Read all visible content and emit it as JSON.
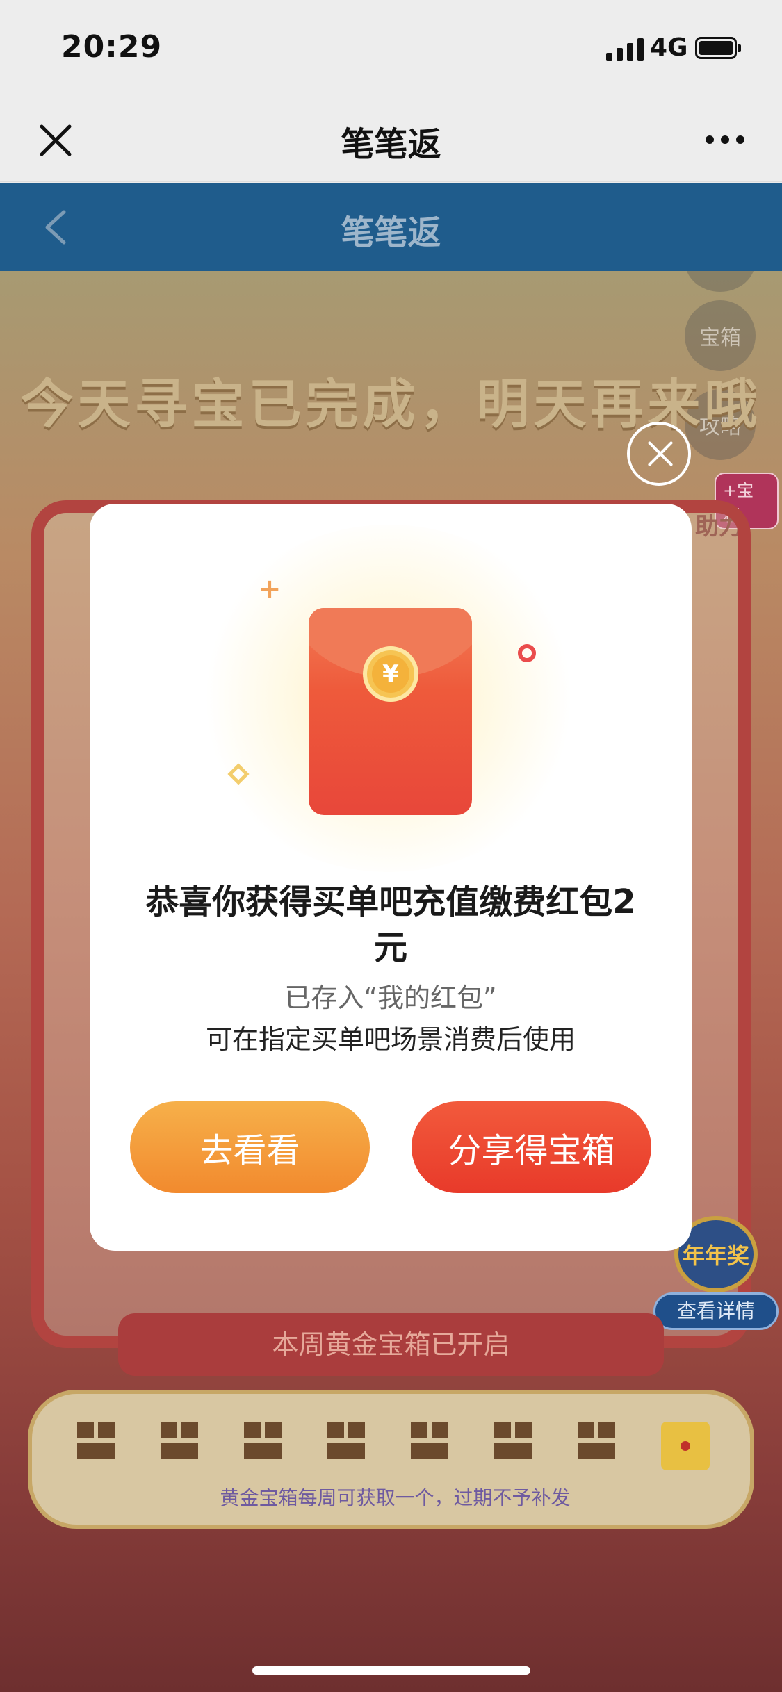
{
  "status_bar": {
    "time": "20:29",
    "network": "4G"
  },
  "wechat_nav": {
    "title": "笔笔返"
  },
  "app_header": {
    "title": "笔笔返"
  },
  "background": {
    "headline": "今天寻宝已完成，明天再来哦",
    "side_buttons": [
      "宝箱",
      "攻略"
    ],
    "helper_tag": "+宝箱",
    "helper_label": "助力",
    "award_badge": "年年奖",
    "detail_button": "查看详情",
    "week_title": "本周黄金宝箱已开启",
    "week_note": "黄金宝箱每周可获取一个，过期不予补发"
  },
  "modal": {
    "coin_symbol": "¥",
    "title": "恭喜你获得买单吧充值缴费红包2元",
    "subtitle": "已存入“我的红包”",
    "description": "可在指定买单吧场景消费后使用",
    "btn_look": "去看看",
    "btn_share": "分享得宝箱"
  }
}
